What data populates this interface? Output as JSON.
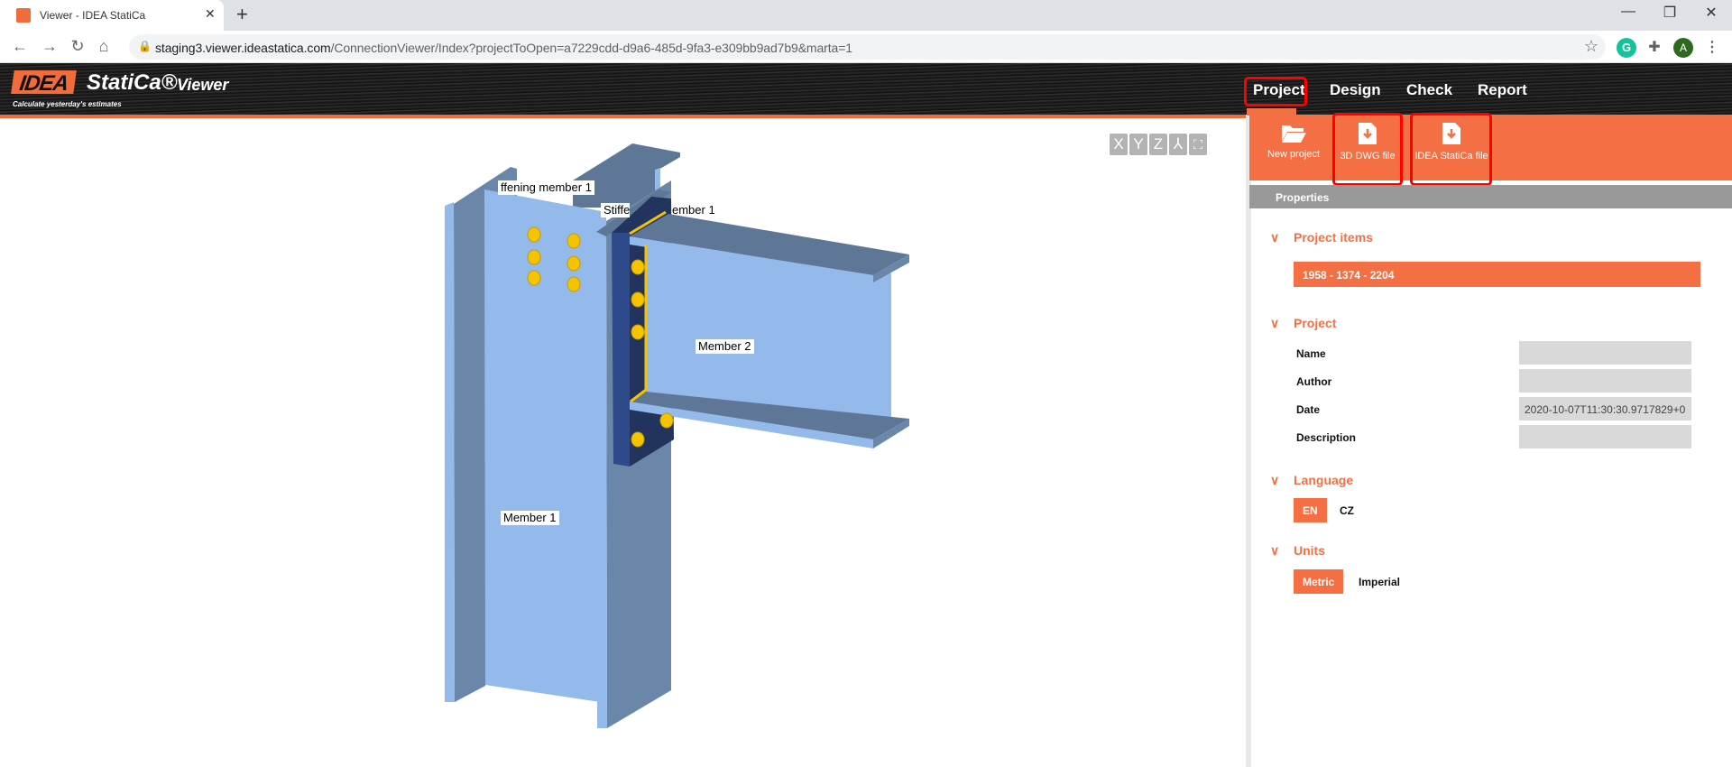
{
  "browser": {
    "tab_title": "Viewer - IDEA StatiCa",
    "url_host": "staging3.viewer.ideastatica.com",
    "url_path": "/ConnectionViewer/Index?projectToOpen=a7229cdd-d9a6-485d-9fa3-e309bb9ad7b9&marta=1",
    "profile_initial": "A"
  },
  "app": {
    "logo_idea": "IDEA",
    "logo_statica": "StatiCa®",
    "logo_viewer": "Viewer",
    "tagline": "Calculate yesterday's estimates",
    "nav": [
      "Project",
      "Design",
      "Check",
      "Report"
    ],
    "active_nav": "Project"
  },
  "viewer": {
    "controls": [
      "X",
      "Y",
      "Z"
    ],
    "labels": {
      "stiffening_1": "ffening member 1",
      "stiffening_2": "Stiffe",
      "stiffening_2b": "ember 1",
      "member_2": "Member 2",
      "member_1": "Member 1"
    },
    "colors": {
      "steel_light": "#94b9eb",
      "steel_dark": "#6a87aa",
      "plate": "#22335e",
      "bolt": "#f5c400"
    }
  },
  "toolbar": {
    "new_project": "New project",
    "dwg": "3D DWG file",
    "idea_file": "IDEA StatiCa file"
  },
  "properties": {
    "title": "Properties",
    "project_items_header": "Project items",
    "project_items": [
      "1958 - 1374 - 2204"
    ],
    "project_header": "Project",
    "fields": [
      {
        "label": "Name",
        "value": ""
      },
      {
        "label": "Author",
        "value": ""
      },
      {
        "label": "Date",
        "value": "2020-10-07T11:30:30.9717829+0"
      },
      {
        "label": "Description",
        "value": ""
      }
    ],
    "language_header": "Language",
    "languages": [
      "EN",
      "CZ"
    ],
    "selected_language": "EN",
    "units_header": "Units",
    "units": [
      "Metric",
      "Imperial"
    ],
    "selected_units": "Metric"
  },
  "accent": "#f47044"
}
